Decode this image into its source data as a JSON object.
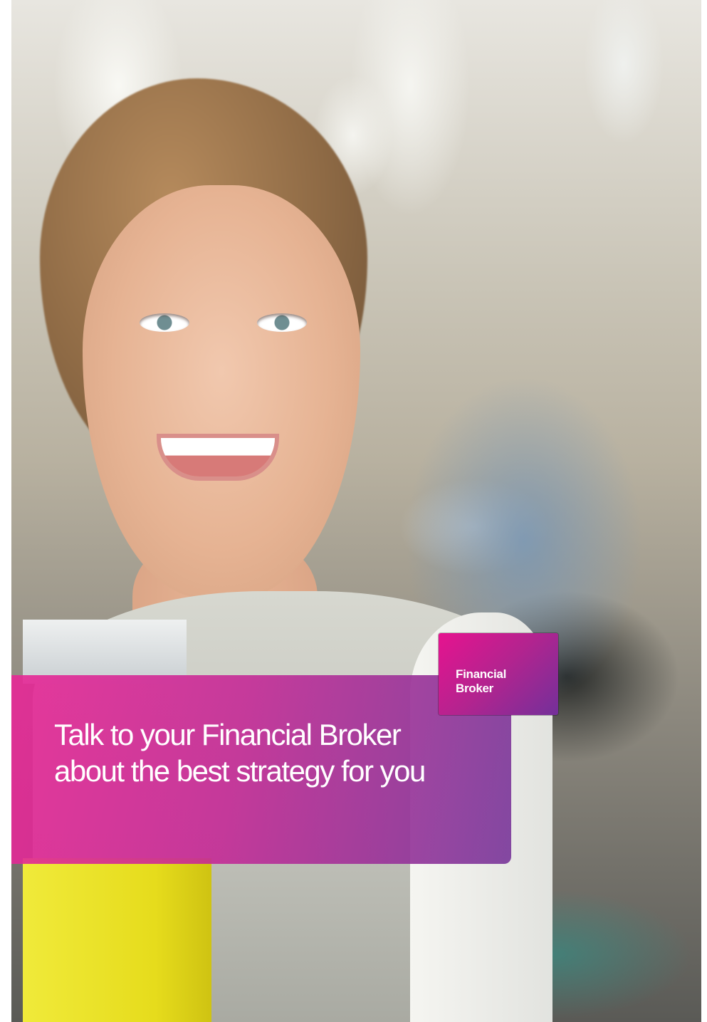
{
  "brochure": {
    "headline_line_1": "Talk to your Financial Broker",
    "headline_line_2": "about the best strategy for you",
    "badge": {
      "line_1": "Financial",
      "line_2": "Broker"
    }
  },
  "colors": {
    "panel_pink": "#e82896",
    "panel_purple": "#7a3a9b",
    "badge_magenta": "#e6138f",
    "badge_purple": "#73309a",
    "text_white": "#ffffff"
  }
}
